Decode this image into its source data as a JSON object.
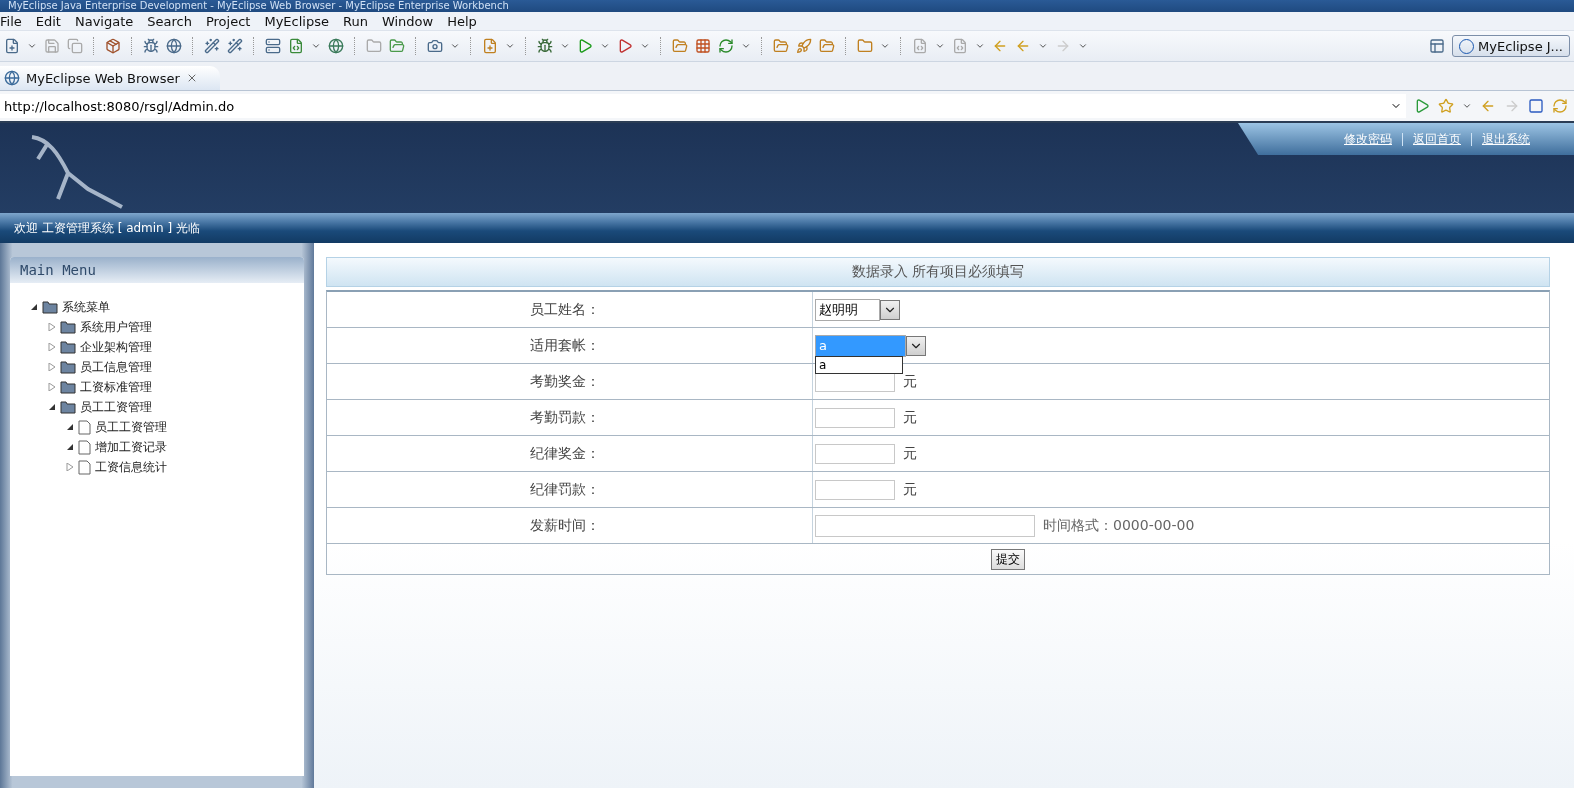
{
  "window": {
    "title": "MyEclipse Java Enterprise Development - MyEclipse Web Browser - MyEclipse Enterprise Workbench"
  },
  "menu": [
    "File",
    "Edit",
    "Navigate",
    "Search",
    "Project",
    "MyEclipse",
    "Run",
    "Window",
    "Help"
  ],
  "perspective_button": "MyEclipse J...",
  "browser_tab": {
    "label": "MyEclipse Web Browser"
  },
  "address_bar": {
    "value": "http://localhost:8080/rsgl/Admin.do"
  },
  "header": {
    "links": [
      "修改密码",
      "返回首页",
      "退出系统"
    ]
  },
  "welcome": "欢迎 工资管理系统 [ admin ] 光临",
  "sidebar": {
    "title": "Main Menu",
    "tree": [
      {
        "label": "系统菜单",
        "kind": "folder",
        "expanded": true,
        "children": [
          {
            "label": "系统用户管理",
            "kind": "folder",
            "expanded": false
          },
          {
            "label": "企业架构管理",
            "kind": "folder",
            "expanded": false
          },
          {
            "label": "员工信息管理",
            "kind": "folder",
            "expanded": false
          },
          {
            "label": "工资标准管理",
            "kind": "folder",
            "expanded": false
          },
          {
            "label": "员工工资管理",
            "kind": "folder",
            "expanded": true,
            "children": [
              {
                "label": "员工工资管理",
                "kind": "page",
                "expanded": true
              },
              {
                "label": "增加工资记录",
                "kind": "page",
                "expanded": true
              },
              {
                "label": "工资信息统计",
                "kind": "page",
                "expanded": false
              }
            ]
          }
        ]
      }
    ]
  },
  "form": {
    "title": "数据录入 所有项目必须填写",
    "fields": [
      {
        "label": "员工姓名：",
        "kind": "select",
        "value": "赵明明"
      },
      {
        "label": "适用套帐：",
        "kind": "select",
        "value": "a",
        "open": true,
        "options": [
          {
            "label": "a"
          }
        ]
      },
      {
        "label": "考勤奖金：",
        "kind": "money",
        "unit": "元"
      },
      {
        "label": "考勤罚款：",
        "kind": "money",
        "unit": "元"
      },
      {
        "label": "纪律奖金：",
        "kind": "money",
        "unit": "元"
      },
      {
        "label": "纪律罚款：",
        "kind": "money",
        "unit": "元"
      },
      {
        "label": "发薪时间：",
        "kind": "date",
        "hint": "时间格式：0000-00-00"
      }
    ],
    "submit": "提交"
  }
}
